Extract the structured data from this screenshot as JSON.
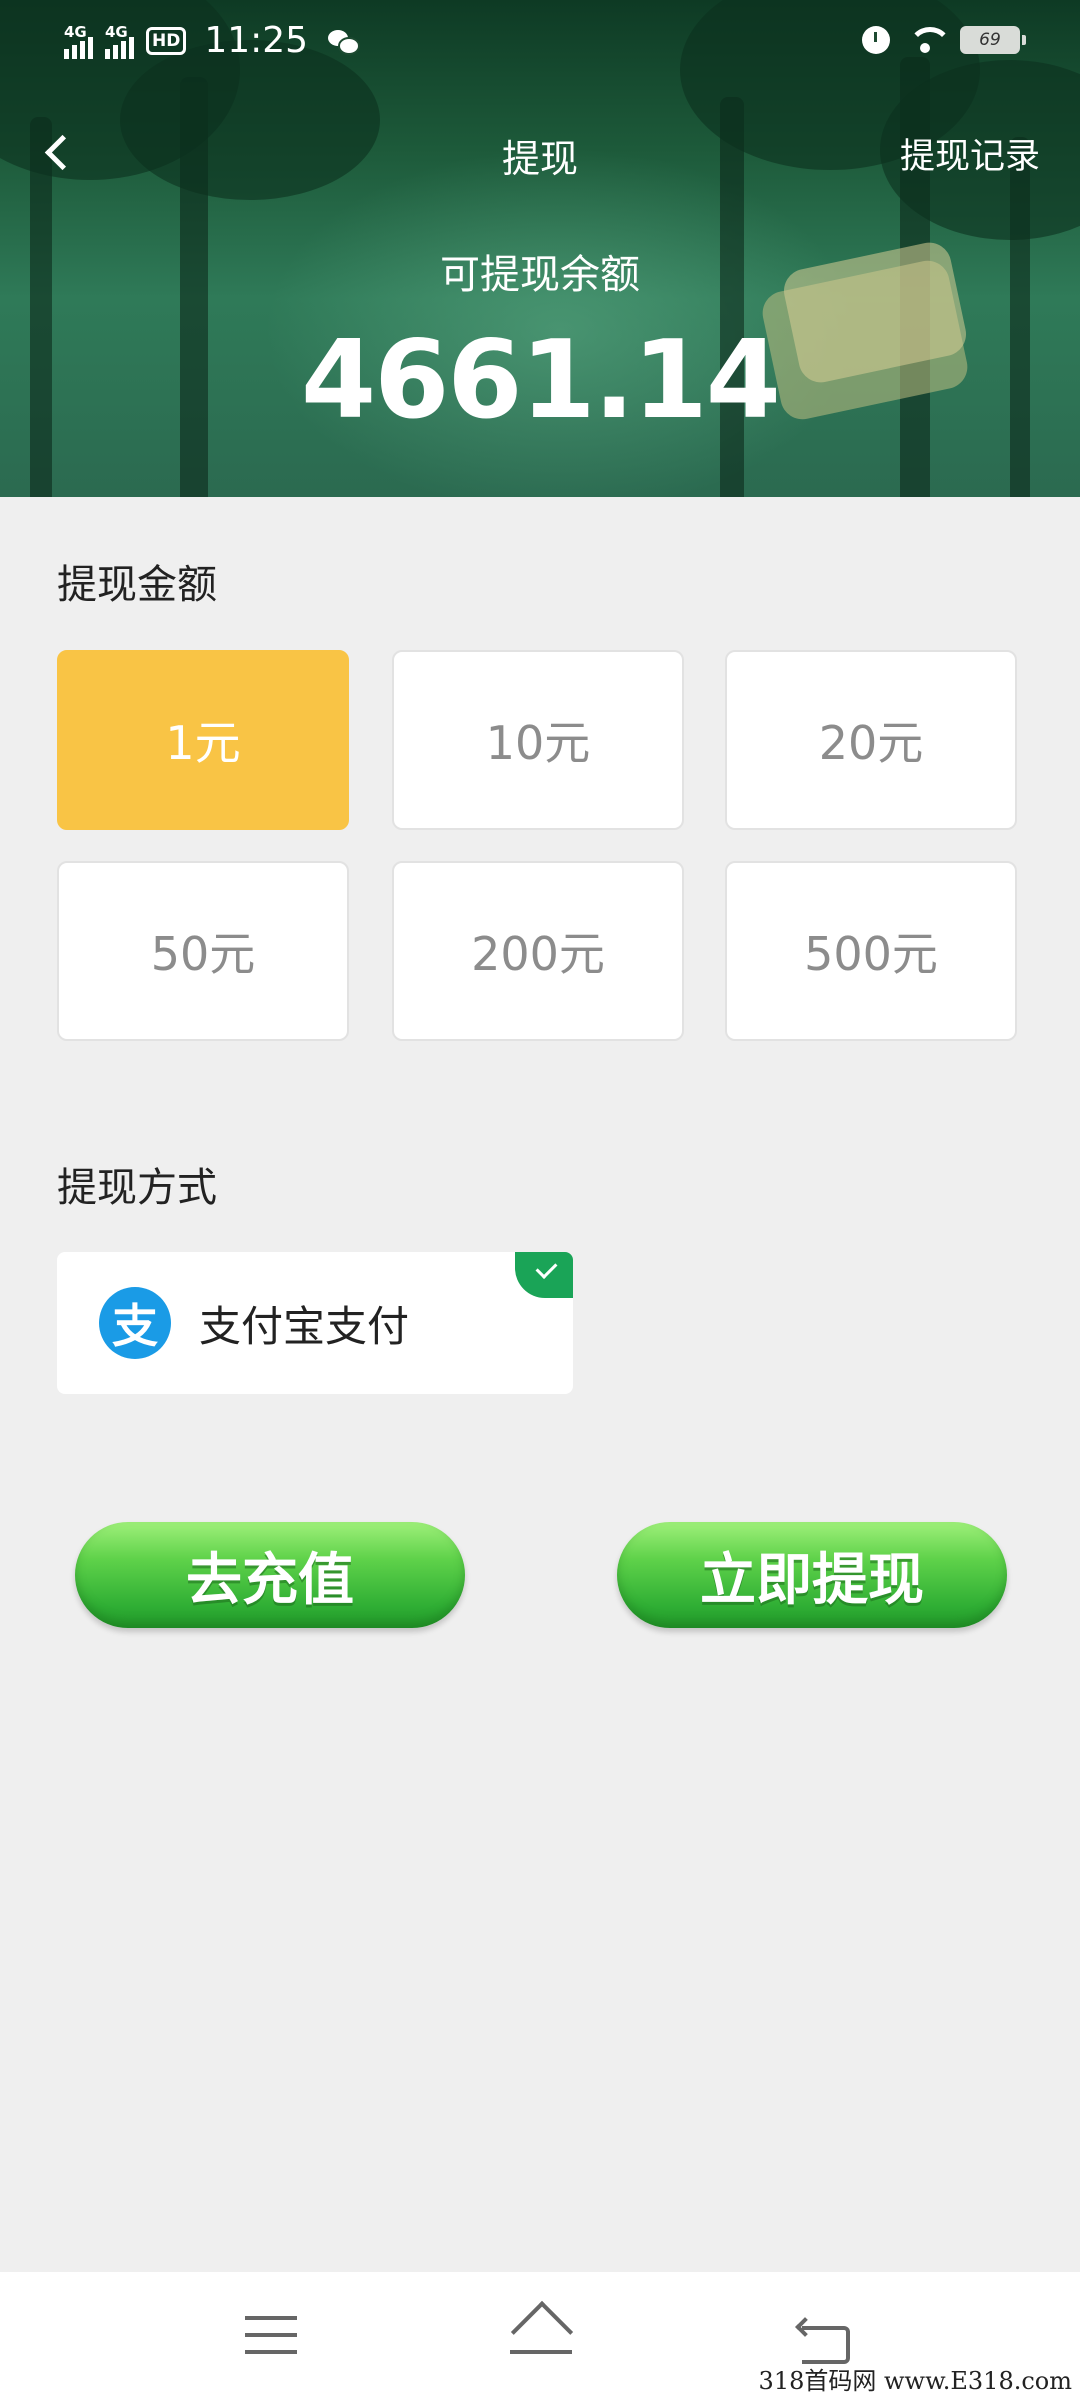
{
  "status_bar": {
    "network_1": "4G",
    "network_2": "4G",
    "hd_badge": "HD",
    "time": "11:25",
    "battery": "69",
    "icons": [
      "signal-icon",
      "signal-icon",
      "hd-icon",
      "wechat-icon",
      "alarm-icon",
      "wifi-icon",
      "battery-icon"
    ]
  },
  "header": {
    "title": "提现",
    "back_icon": "chevron-left-icon",
    "record_link": "提现记录",
    "balance_label": "可提现余额",
    "balance_value": "4661.14"
  },
  "amount_section": {
    "title": "提现金额",
    "selected_index": 0,
    "options": [
      {
        "label": "1元",
        "selected": true
      },
      {
        "label": "10元",
        "selected": false
      },
      {
        "label": "20元",
        "selected": false
      },
      {
        "label": "50元",
        "selected": false
      },
      {
        "label": "200元",
        "selected": false
      },
      {
        "label": "500元",
        "selected": false
      }
    ],
    "selected_color": "#f9c445"
  },
  "method_section": {
    "title": "提现方式",
    "method": {
      "logo_char": "支",
      "label": "支付宝支付",
      "selected": true,
      "logo_color": "#1a9be6",
      "check_color": "#1aa457"
    }
  },
  "actions": {
    "recharge": "去充值",
    "withdraw": "立即提现",
    "button_color": "#3cb93a"
  },
  "nav_bar": {
    "icons": [
      "menu-icon",
      "home-icon",
      "back-icon"
    ]
  },
  "watermark": "318首码网 www.E318.com"
}
